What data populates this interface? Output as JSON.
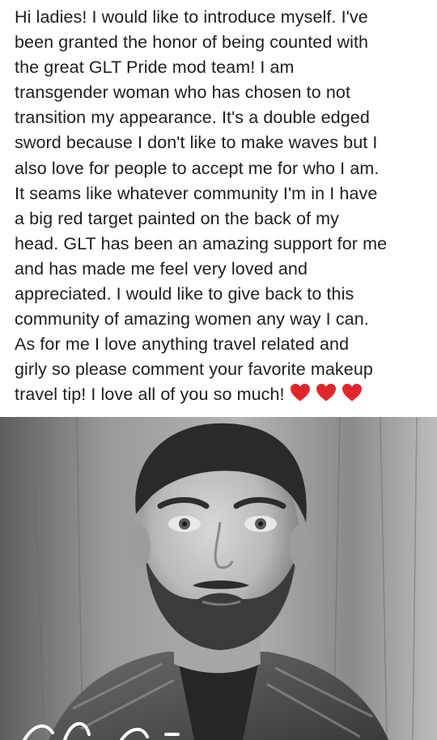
{
  "post": {
    "lines": [
      "Hi ladies! I would like to introduce myself. I've",
      "been granted the honor of being counted with",
      "the great GLT Pride mod team! I am",
      "transgender woman who has chosen to not",
      "transition my appearance. It's a double edged",
      "sword because I don't like to make waves but I",
      "also love for people to accept me for who I am.",
      "It seams like whatever community I'm in I have",
      "a big red target painted on the back of my",
      "head. GLT has been an amazing support for me",
      "and has made me feel very loved and",
      "appreciated. I would like to give back to this",
      "community of amazing women any way I can.",
      "As for me I love anything travel related and",
      "girly so please comment your favorite makeup",
      "travel tip! I love all of you so much!"
    ],
    "emoji": [
      "red-heart-icon",
      "red-heart-icon",
      "red-heart-icon"
    ],
    "heart_color": "#e0262d"
  },
  "photo": {
    "icon": "portrait-photo",
    "tone": "black-and-white"
  }
}
